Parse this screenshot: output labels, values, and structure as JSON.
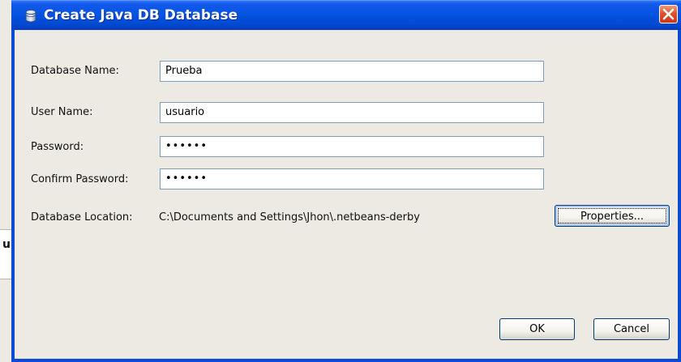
{
  "background_app": {
    "partial_glyph": "u"
  },
  "dialog": {
    "title": "Create Java DB Database",
    "title_icon": "database-cylinder-icon",
    "close_icon": "close-icon"
  },
  "form": {
    "database_name_label": "Database Name:",
    "database_name_value": "Prueba",
    "user_name_label": "User Name:",
    "user_name_value": "usuario",
    "password_label": "Password:",
    "password_value": "••••••",
    "confirm_password_label": "Confirm Password:",
    "confirm_password_value": "••••••",
    "location_label": "Database Location:",
    "location_value": "C:\\Documents and Settings\\Jhon\\.netbeans-derby"
  },
  "buttons": {
    "properties_label": "Properties...",
    "ok_label": "OK",
    "cancel_label": "Cancel"
  },
  "colors": {
    "titlebar": "#0654e3",
    "close_button": "#e2512b",
    "client_background": "#eceae3",
    "field_border": "#7f9db9"
  }
}
